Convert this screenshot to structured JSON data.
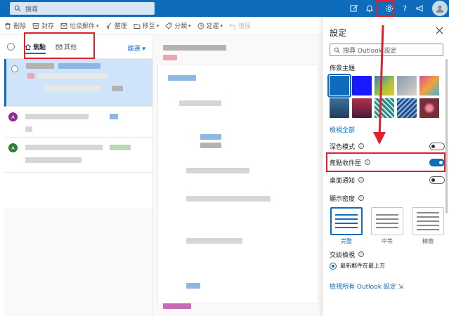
{
  "topbar": {
    "search_placeholder": "搜尋"
  },
  "toolbar": {
    "items": [
      {
        "label": "刪除",
        "icon": "trash-icon"
      },
      {
        "label": "封存",
        "icon": "archive-icon"
      },
      {
        "label": "垃圾郵件",
        "icon": "block-icon"
      },
      {
        "label": "整理",
        "icon": "broom-icon"
      },
      {
        "label": "移至",
        "icon": "folder-move-icon"
      },
      {
        "label": "分類",
        "icon": "tag-icon"
      },
      {
        "label": "延遲",
        "icon": "clock-icon"
      },
      {
        "label": "復原",
        "icon": "undo-icon"
      }
    ]
  },
  "message_list": {
    "tab_focused": "焦點",
    "tab_other": "其他",
    "filter": "篩選",
    "avatar_initial": "A"
  },
  "settings": {
    "title": "設定",
    "search_placeholder": "搜尋 Outlook 設定",
    "theme_label": "佈景主題",
    "view_all": "檢視全部",
    "dark_mode": "深色模式",
    "focused_inbox": "焦點收件匣",
    "desktop_notifications": "桌面通知",
    "display_density_label": "顯示密度",
    "density_options": [
      "完整",
      "中等",
      "精簡"
    ],
    "conversation_view_label": "交談檢視",
    "newest_on_top": "最新郵件在最上方",
    "view_all_settings": "檢視所有 Outlook 設定",
    "theme_colors": [
      "#0f6cbd",
      "#1a1aff",
      "#3d7cc2",
      "#8a9bb0",
      "#d94fa0",
      "#3a6f9c",
      "#b0304a",
      "#2b8a8a",
      "#234f8a",
      "#7a2e3a"
    ]
  },
  "colors": {
    "accent": "#0f6cbd",
    "highlight_red": "#e0202a",
    "avatar_purple": "#8e2c94",
    "avatar_green": "#2e7d32"
  }
}
